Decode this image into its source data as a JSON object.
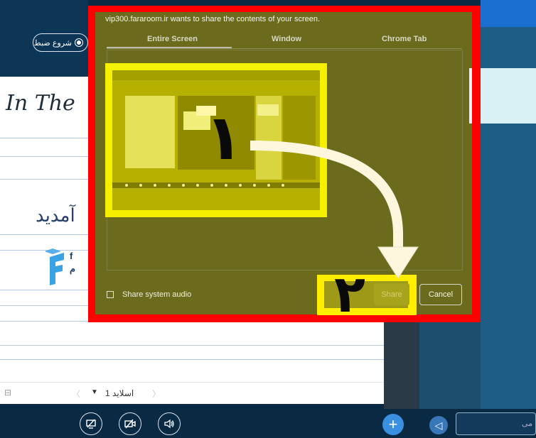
{
  "header": {
    "record_label": "شروع ضبط"
  },
  "slide": {
    "script_title": "In The",
    "welcome_text": "آمدید",
    "logo_text_line1": "f",
    "logo_text_line2": "م"
  },
  "slide_nav": {
    "label": "اسلاید 1"
  },
  "chat": {
    "input_placeholder": "می"
  },
  "dialog": {
    "title": "vip300.fararoom.ir wants to share the contents of your screen.",
    "tabs": [
      {
        "label": "Entire Screen",
        "active": true
      },
      {
        "label": "Window",
        "active": false
      },
      {
        "label": "Chrome Tab",
        "active": false
      }
    ],
    "share_audio_label": "Share system audio",
    "share_audio_checked": false,
    "share_button": "Share",
    "cancel_button": "Cancel"
  },
  "annotations": {
    "step_one": "۱",
    "step_two": "۲"
  },
  "colors": {
    "highlight_frame": "#ff0000",
    "thumb_highlight": "#f4f000",
    "share_highlight": "#ffee00",
    "arrow": "#fff6de",
    "dialog_bg": "#6b6a1d"
  }
}
